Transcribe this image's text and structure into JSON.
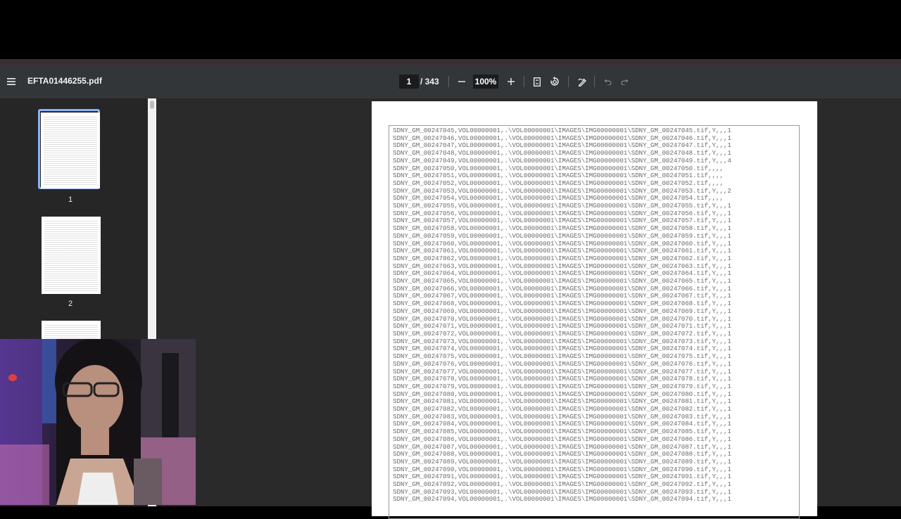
{
  "toolbar": {
    "filename": "EFTA01446255.pdf",
    "current_page": "1",
    "total_pages": "/ 343",
    "zoom": "100%"
  },
  "sidebar": {
    "thumbnails": [
      {
        "number": "1",
        "selected": true
      },
      {
        "number": "2",
        "selected": false
      }
    ]
  },
  "document": {
    "lines": [
      "SDNY_GM_00247045,VOL00000001,.\\VOL00000001\\IMAGES\\IMG00000001\\SDNY_GM_00247045.tif,Y,,,1",
      "SDNY_GM_00247046,VOL00000001,.\\VOL00000001\\IMAGES\\IMG00000001\\SDNY_GM_00247046.tif,Y,,,1",
      "SDNY_GM_00247047,VOL00000001,.\\VOL00000001\\IMAGES\\IMG00000001\\SDNY_GM_00247047.tif,Y,,,1",
      "SDNY_GM_00247048,VOL00000001,.\\VOL00000001\\IMAGES\\IMG00000001\\SDNY_GM_00247048.tif,Y,,,1",
      "SDNY_GM_00247049,VOL00000001,.\\VOL00000001\\IMAGES\\IMG00000001\\SDNY_GM_00247049.tif,Y,,,4",
      "SDNY_GM_00247050,VOL00000001,.\\VOL00000001\\IMAGES\\IMG00000001\\SDNY_GM_00247050.tif,,,,",
      "SDNY_GM_00247051,VOL00000001,.\\VOL00000001\\IMAGES\\IMG00000001\\SDNY_GM_00247051.tif,,,,",
      "SDNY_GM_00247052,VOL00000001,.\\VOL00000001\\IMAGES\\IMG00000001\\SDNY_GM_00247052.tif,,,,",
      "SDNY_GM_00247053,VOL00000001,.\\VOL00000001\\IMAGES\\IMG00000001\\SDNY_GM_00247053.tif,Y,,,2",
      "SDNY_GM_00247054,VOL00000001,.\\VOL00000001\\IMAGES\\IMG00000001\\SDNY_GM_00247054.tif,,,,",
      "SDNY_GM_00247055,VOL00000001,.\\VOL00000001\\IMAGES\\IMG00000001\\SDNY_GM_00247055.tif,Y,,,1",
      "SDNY_GM_00247056,VOL00000001,.\\VOL00000001\\IMAGES\\IMG00000001\\SDNY_GM_00247056.tif,Y,,,1",
      "SDNY_GM_00247057,VOL00000001,.\\VOL00000001\\IMAGES\\IMG00000001\\SDNY_GM_00247057.tif,Y,,,1",
      "SDNY_GM_00247058,VOL00000001,.\\VOL00000001\\IMAGES\\IMG00000001\\SDNY_GM_00247058.tif,Y,,,1",
      "SDNY_GM_00247059,VOL00000001,.\\VOL00000001\\IMAGES\\IMG00000001\\SDNY_GM_00247059.tif,Y,,,1",
      "SDNY_GM_00247060,VOL00000001,.\\VOL00000001\\IMAGES\\IMG00000001\\SDNY_GM_00247060.tif,Y,,,1",
      "SDNY_GM_00247061,VOL00000001,.\\VOL00000001\\IMAGES\\IMG00000001\\SDNY_GM_00247061.tif,Y,,,1",
      "SDNY_GM_00247062,VOL00000001,.\\VOL00000001\\IMAGES\\IMG00000001\\SDNY_GM_00247062.tif,Y,,,1",
      "SDNY_GM_00247063,VOL00000001,.\\VOL00000001\\IMAGES\\IMG00000001\\SDNY_GM_00247063.tif,Y,,,1",
      "SDNY_GM_00247064,VOL00000001,.\\VOL00000001\\IMAGES\\IMG00000001\\SDNY_GM_00247064.tif,Y,,,1",
      "SDNY_GM_00247065,VOL00000001,.\\VOL00000001\\IMAGES\\IMG00000001\\SDNY_GM_00247065.tif,Y,,,1",
      "SDNY_GM_00247066,VOL00000001,.\\VOL00000001\\IMAGES\\IMG00000001\\SDNY_GM_00247066.tif,Y,,,1",
      "SDNY_GM_00247067,VOL00000001,.\\VOL00000001\\IMAGES\\IMG00000001\\SDNY_GM_00247067.tif,Y,,,1",
      "SDNY_GM_00247068,VOL00000001,.\\VOL00000001\\IMAGES\\IMG00000001\\SDNY_GM_00247068.tif,Y,,,1",
      "SDNY_GM_00247069,VOL00000001,.\\VOL00000001\\IMAGES\\IMG00000001\\SDNY_GM_00247069.tif,Y,,,1",
      "SDNY_GM_00247070,VOL00000001,.\\VOL00000001\\IMAGES\\IMG00000001\\SDNY_GM_00247070.tif,Y,,,1",
      "SDNY_GM_00247071,VOL00000001,.\\VOL00000001\\IMAGES\\IMG00000001\\SDNY_GM_00247071.tif,Y,,,1",
      "SDNY_GM_00247072,VOL00000001,.\\VOL00000001\\IMAGES\\IMG00000001\\SDNY_GM_00247072.tif,Y,,,1",
      "SDNY_GM_00247073,VOL00000001,.\\VOL00000001\\IMAGES\\IMG00000001\\SDNY_GM_00247073.tif,Y,,,1",
      "SDNY_GM_00247074,VOL00000001,.\\VOL00000001\\IMAGES\\IMG00000001\\SDNY_GM_00247074.tif,Y,,,1",
      "SDNY_GM_00247075,VOL00000001,.\\VOL00000001\\IMAGES\\IMG00000001\\SDNY_GM_00247075.tif,Y,,,1",
      "SDNY_GM_00247076,VOL00000001,.\\VOL00000001\\IMAGES\\IMG00000001\\SDNY_GM_00247076.tif,Y,,,1",
      "SDNY_GM_00247077,VOL00000001,.\\VOL00000001\\IMAGES\\IMG00000001\\SDNY_GM_00247077.tif,Y,,,1",
      "SDNY_GM_00247078,VOL00000001,.\\VOL00000001\\IMAGES\\IMG00000001\\SDNY_GM_00247078.tif,Y,,,1",
      "SDNY_GM_00247079,VOL00000001,.\\VOL00000001\\IMAGES\\IMG00000001\\SDNY_GM_00247079.tif,Y,,,1",
      "SDNY_GM_00247080,VOL00000001,.\\VOL00000001\\IMAGES\\IMG00000001\\SDNY_GM_00247080.tif,Y,,,1",
      "SDNY_GM_00247081,VOL00000001,.\\VOL00000001\\IMAGES\\IMG00000001\\SDNY_GM_00247081.tif,Y,,,1",
      "SDNY_GM_00247082,VOL00000001,.\\VOL00000001\\IMAGES\\IMG00000001\\SDNY_GM_00247082.tif,Y,,,1",
      "SDNY_GM_00247083,VOL00000001,.\\VOL00000001\\IMAGES\\IMG00000001\\SDNY_GM_00247083.tif,Y,,,1",
      "SDNY_GM_00247084,VOL00000001,.\\VOL00000001\\IMAGES\\IMG00000001\\SDNY_GM_00247084.tif,Y,,,1",
      "SDNY_GM_00247085,VOL00000001,.\\VOL00000001\\IMAGES\\IMG00000001\\SDNY_GM_00247085.tif,Y,,,1",
      "SDNY_GM_00247086,VOL00000001,.\\VOL00000001\\IMAGES\\IMG00000001\\SDNY_GM_00247086.tif,Y,,,1",
      "SDNY_GM_00247087,VOL00000001,.\\VOL00000001\\IMAGES\\IMG00000001\\SDNY_GM_00247087.tif,Y,,,1",
      "SDNY_GM_00247088,VOL00000001,.\\VOL00000001\\IMAGES\\IMG00000001\\SDNY_GM_00247088.tif,Y,,,1",
      "SDNY_GM_00247089,VOL00000001,.\\VOL00000001\\IMAGES\\IMG00000001\\SDNY_GM_00247089.tif,Y,,,1",
      "SDNY_GM_00247090,VOL00000001,.\\VOL00000001\\IMAGES\\IMG00000001\\SDNY_GM_00247090.tif,Y,,,1",
      "SDNY_GM_00247091,VOL00000001,.\\VOL00000001\\IMAGES\\IMG00000001\\SDNY_GM_00247091.tif,Y,,,1",
      "SDNY_GM_00247092,VOL00000001,.\\VOL00000001\\IMAGES\\IMG00000001\\SDNY_GM_00247092.tif,Y,,,1",
      "SDNY_GM_00247093,VOL00000001,.\\VOL00000001\\IMAGES\\IMG00000001\\SDNY_GM_00247093.tif,Y,,,1",
      "SDNY_GM_00247094,VOL00000001,.\\VOL00000001\\IMAGES\\IMG00000001\\SDNY_GM_00247094.tif,Y,,,1"
    ]
  },
  "icons": {
    "menu": "hamburger-menu-icon",
    "zoom_out": "minus-icon",
    "zoom_in": "plus-icon",
    "fit": "fit-page-icon",
    "rotate": "rotate-icon",
    "annotate": "annotate-pen-icon",
    "undo": "undo-icon",
    "redo": "redo-icon"
  },
  "colors": {
    "toolbar_bg": "#323639",
    "sidebar_bg": "#262626",
    "viewer_bg": "#2a2a2a",
    "selection_border": "#8ab4f8"
  }
}
